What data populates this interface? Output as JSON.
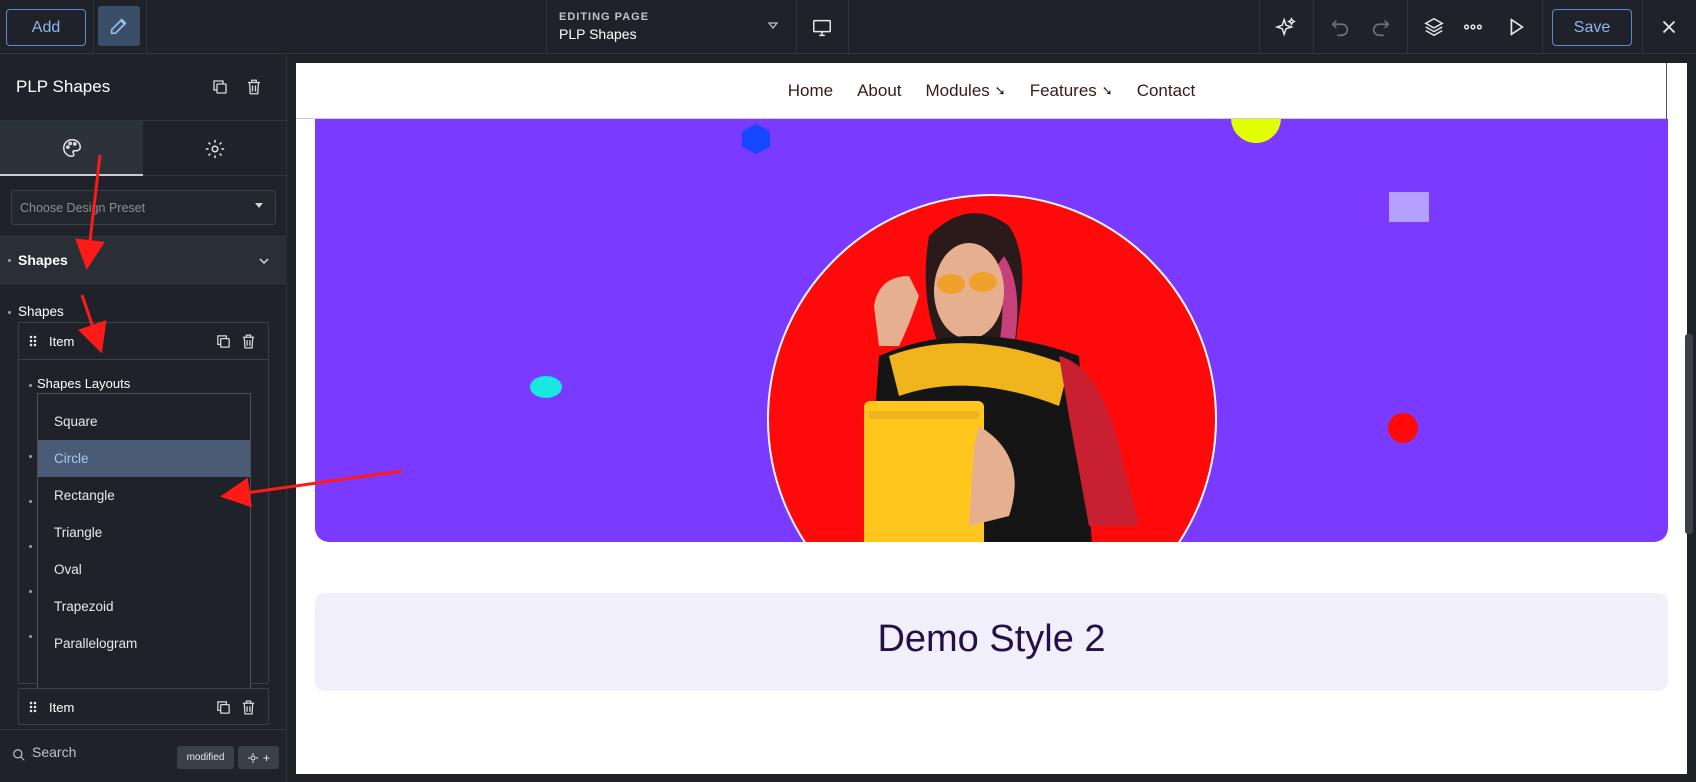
{
  "topbar": {
    "add_label": "Add",
    "editing_label": "EDITING PAGE",
    "editing_value": "PLP Shapes",
    "save_label": "Save",
    "icons": [
      "edit-icon",
      "desktop-icon",
      "ai-sparkle-icon",
      "undo-icon",
      "redo-icon",
      "layers-icon",
      "more-icon",
      "play-icon",
      "close-icon"
    ]
  },
  "sidebar": {
    "title": "PLP Shapes",
    "tabs": [
      {
        "name": "design",
        "icon": "palette-icon"
      },
      {
        "name": "settings",
        "icon": "gear-icon"
      }
    ],
    "preset_placeholder": "Choose Design Preset",
    "section_title": "Shapes",
    "shapes_label": "Shapes",
    "items": [
      {
        "label": "Item"
      },
      {
        "label": "Item"
      }
    ],
    "layouts_label": "Shapes Layouts",
    "options": [
      "Square",
      "Circle",
      "Rectangle",
      "Triangle",
      "Oval",
      "Trapezoid",
      "Parallelogram"
    ],
    "selected_option": "Circle",
    "search_label": "Search",
    "modified_label": "modified"
  },
  "preview": {
    "nav": [
      {
        "label": "Home",
        "has_arrow": false
      },
      {
        "label": "About",
        "has_arrow": false
      },
      {
        "label": "Modules",
        "has_arrow": true
      },
      {
        "label": "Features",
        "has_arrow": true
      },
      {
        "label": "Contact",
        "has_arrow": false
      }
    ],
    "nav_arrow": "➘",
    "demo_title": "Demo Style 2",
    "colors": {
      "hero": "#7a3aff",
      "circle": "#ff0a0a",
      "demo_card": "#f1effa"
    }
  }
}
